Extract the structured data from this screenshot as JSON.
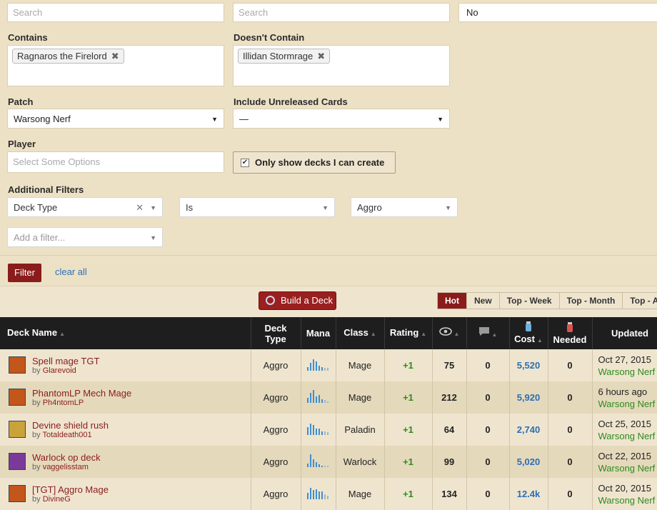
{
  "filters": {
    "search1_placeholder": "Search",
    "search2_placeholder": "Search",
    "top_select_value": "No",
    "contains_label": "Contains",
    "contains_tag": "Ragnaros the Firelord",
    "doesnt_contain_label": "Doesn't Contain",
    "doesnt_contain_tag": "Illidan Stormrage",
    "patch_label": "Patch",
    "patch_value": "Warsong Nerf",
    "unreleased_label": "Include Unreleased Cards",
    "unreleased_value": "—",
    "player_label": "Player",
    "player_placeholder": "Select Some Options",
    "only_show_label": "Only show decks I can create",
    "additional_label": "Additional Filters",
    "filter_field": "Deck Type",
    "filter_op": "Is",
    "filter_value": "Aggro",
    "add_filter_placeholder": "Add a filter...",
    "filter_button": "Filter",
    "clear_all": "clear all"
  },
  "build_deck": "Build a Deck",
  "sort_tabs": [
    "Hot",
    "New",
    "Top - Week",
    "Top - Month",
    "Top - All"
  ],
  "table": {
    "headers": {
      "deck_name": "Deck Name",
      "deck_type_1": "Deck",
      "deck_type_2": "Type",
      "mana": "Mana",
      "class": "Class",
      "rating": "Rating",
      "cost": "Cost",
      "needed": "Needed",
      "updated": "Updated"
    },
    "rows": [
      {
        "name": "Spell mage TGT",
        "by": "by ",
        "author": "Glarevoid",
        "type": "Aggro",
        "class": "Mage",
        "rating": "+1",
        "views": "75",
        "comments": "0",
        "cost": "5,520",
        "needed": "0",
        "updated": "Oct 27, 2015",
        "patch": "Warsong Nerf",
        "icon_color": "#c2561b"
      },
      {
        "name": "PhantomLP Mech Mage",
        "by": "by ",
        "author": "Ph4ntomLP",
        "type": "Aggro",
        "class": "Mage",
        "rating": "+1",
        "views": "212",
        "comments": "0",
        "cost": "5,920",
        "needed": "0",
        "updated": "6 hours ago",
        "patch": "Warsong Nerf",
        "icon_color": "#c2561b"
      },
      {
        "name": "Devine shield rush",
        "by": "by ",
        "author": "Totaldeath001",
        "type": "Aggro",
        "class": "Paladin",
        "rating": "+1",
        "views": "64",
        "comments": "0",
        "cost": "2,740",
        "needed": "0",
        "updated": "Oct 25, 2015",
        "patch": "Warsong Nerf",
        "icon_color": "#c9a23a"
      },
      {
        "name": "Warlock op deck",
        "by": "by ",
        "author": "vaggelisstam",
        "type": "Aggro",
        "class": "Warlock",
        "rating": "+1",
        "views": "99",
        "comments": "0",
        "cost": "5,020",
        "needed": "0",
        "updated": "Oct 22, 2015",
        "patch": "Warsong Nerf",
        "icon_color": "#7a3a9a"
      },
      {
        "name": "[TGT] Aggro Mage",
        "by": "by ",
        "author": "DivineG",
        "type": "Aggro",
        "class": "Mage",
        "rating": "+1",
        "views": "134",
        "comments": "0",
        "cost": "12.4k",
        "needed": "0",
        "updated": "Oct 20, 2015",
        "patch": "Warsong Nerf",
        "icon_color": "#c2561b"
      }
    ]
  },
  "icons": [
    "search-icon",
    "remove-tag-icon",
    "chevron-down-icon",
    "checkbox-icon",
    "hearthstone-icon",
    "eye-icon",
    "comment-icon",
    "dust-icon",
    "potion-icon",
    "class-icon",
    "mana-curve-icon"
  ]
}
